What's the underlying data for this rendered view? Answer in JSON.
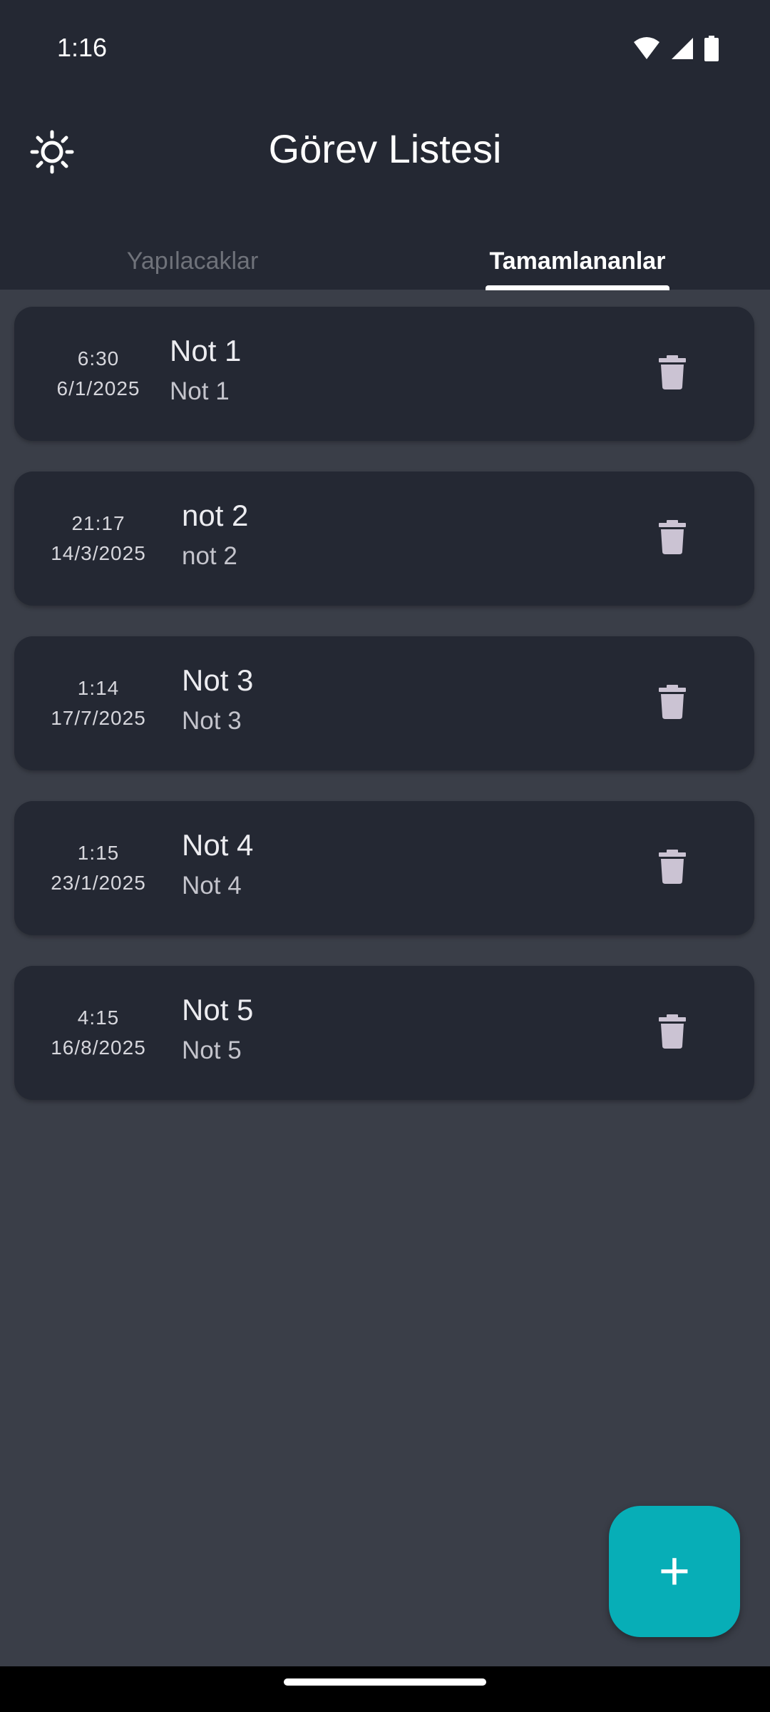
{
  "status_bar": {
    "time": "1:16",
    "icons": [
      "wifi-icon",
      "signal-icon",
      "battery-icon"
    ]
  },
  "header": {
    "title": "Görev Listesi",
    "theme_icon": "sun-icon"
  },
  "tabs": [
    {
      "label": "Yapılacaklar",
      "active": false
    },
    {
      "label": "Tamamlananlar",
      "active": true
    }
  ],
  "tasks": [
    {
      "time": "6:30",
      "date": "6/1/2025",
      "title": "Not 1",
      "subtitle": "Not 1"
    },
    {
      "time": "21:17",
      "date": "14/3/2025",
      "title": "not 2",
      "subtitle": "not 2"
    },
    {
      "time": "1:14",
      "date": "17/7/2025",
      "title": "Not 3",
      "subtitle": "Not 3"
    },
    {
      "time": "1:15",
      "date": "23/1/2025",
      "title": "Not 4",
      "subtitle": "Not 4"
    },
    {
      "time": "4:15",
      "date": "16/8/2025",
      "title": "Not 5",
      "subtitle": "Not 5"
    }
  ],
  "fab": {
    "icon": "plus-icon",
    "symbol": "+"
  },
  "colors": {
    "app_bar": "#242833",
    "background": "#3a3e48",
    "card": "#242833",
    "accent": "#07aeb7",
    "delete_icon": "#cbc3d3"
  }
}
